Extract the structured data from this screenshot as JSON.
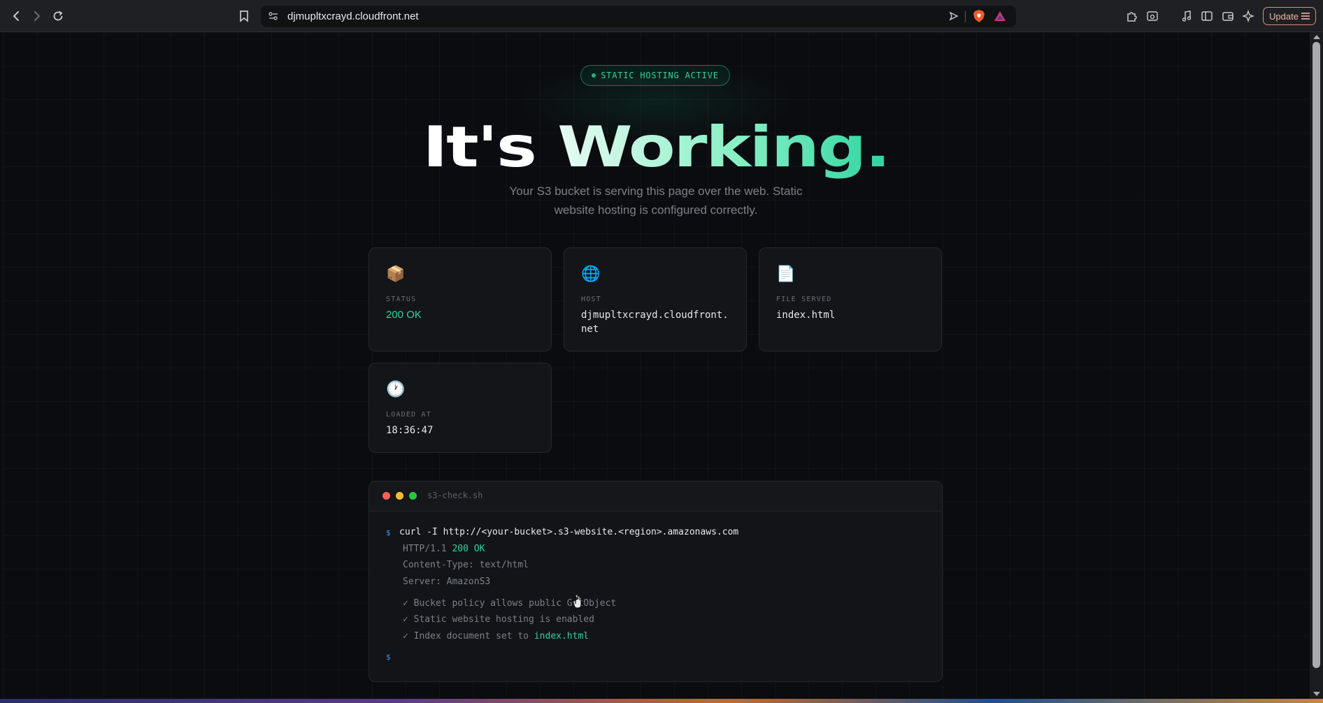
{
  "browser": {
    "url": "djmupltxcrayd.cloudfront.net",
    "update_label": "Update"
  },
  "page": {
    "badge": "STATIC HOSTING ACTIVE",
    "title_part1": "It's",
    "title_part2": "Working.",
    "subtitle": "Your S3 bucket is serving this page over the web. Static website hosting is configured correctly.",
    "cards": [
      {
        "icon": "📦",
        "icon_name": "package-icon",
        "label": "STATUS",
        "value": "200 OK"
      },
      {
        "icon": "🌐",
        "icon_name": "globe-icon",
        "label": "HOST",
        "value": "djmupltxcrayd.cloudfront.net"
      },
      {
        "icon": "📄",
        "icon_name": "document-icon",
        "label": "FILE SERVED",
        "value": "index.html"
      },
      {
        "icon": "🕐",
        "icon_name": "clock-icon",
        "label": "LOADED AT",
        "value": "18:36:47"
      }
    ],
    "terminal": {
      "title": "s3-check.sh",
      "prompt": "$",
      "command": "curl -I http://<your-bucket>.s3-website.<region>.amazonaws.com",
      "http_prefix": "HTTP/1.1 ",
      "http_status": "200 OK",
      "content_type": "Content-Type: text/html",
      "server": "Server: AmazonS3",
      "check1": "✓ Bucket policy allows public GetObject",
      "check2": "✓ Static website hosting is enabled",
      "check3_prefix": "✓ Index document set to ",
      "check3_file": "index.html"
    }
  },
  "colors": {
    "accent": "#34d399",
    "background": "#0b0c0f",
    "card": "#131519",
    "prompt": "#4f8ff7"
  }
}
